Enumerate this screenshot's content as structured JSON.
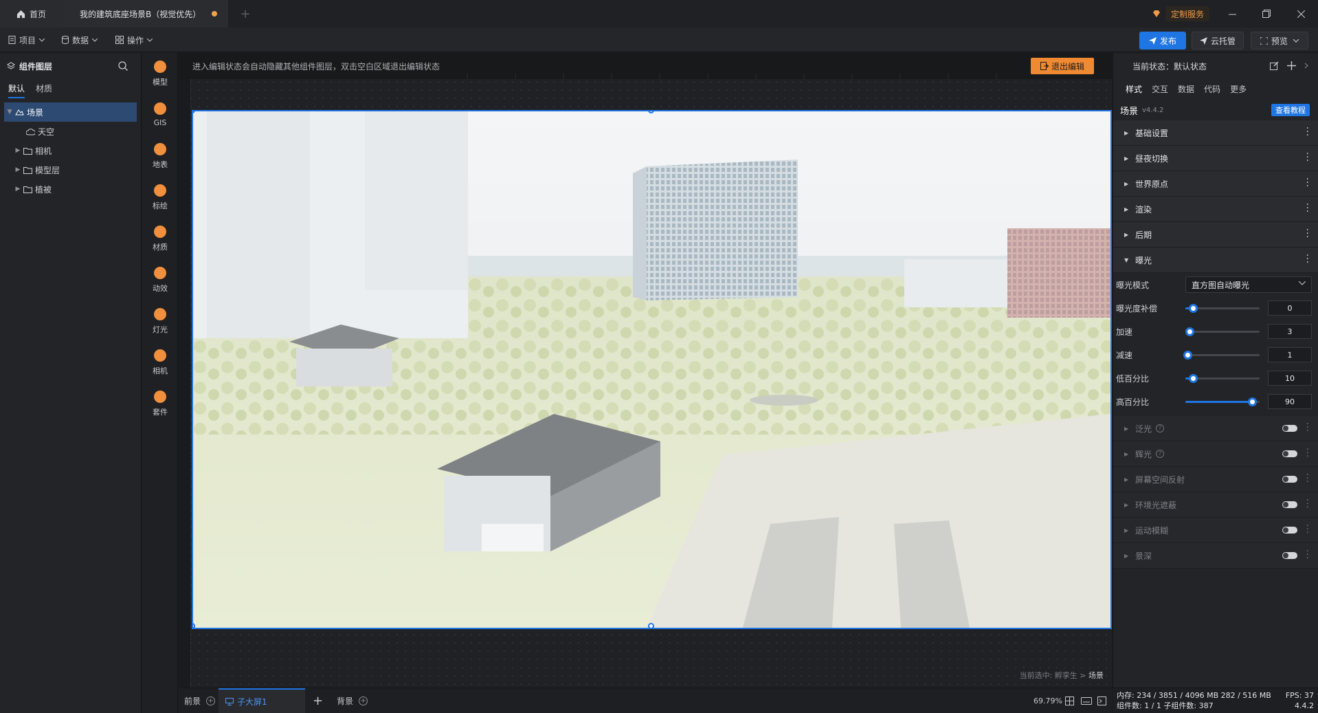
{
  "titlebar": {
    "home_tab": "首页",
    "doc_tab": "我的建筑底座场景B（视觉优先）",
    "custom_service": "定制服务"
  },
  "menubar": {
    "project": "项目",
    "data": "数据",
    "operation": "操作",
    "publish": "发布",
    "cloud": "云托管",
    "preview": "预览"
  },
  "layers": {
    "title": "组件图层",
    "tabs": [
      "默认",
      "材质"
    ],
    "tree": [
      {
        "label": "场景",
        "icon": "scene-icon"
      },
      {
        "label": "天空",
        "icon": "cloud-icon"
      },
      {
        "label": "相机",
        "icon": "folder-icon"
      },
      {
        "label": "模型层",
        "icon": "folder-icon"
      },
      {
        "label": "植被",
        "icon": "folder-icon"
      }
    ]
  },
  "components": [
    "模型",
    "GIS",
    "地表",
    "标绘",
    "材质",
    "动效",
    "灯光",
    "相机",
    "套件"
  ],
  "canvas": {
    "hint": "进入编辑状态会自动隐藏其他组件图层，双击空白区域退出编辑状态",
    "exit_edit": "退出编辑",
    "selected_prefix": "当前选中: 孵孪生 >",
    "selected_current": "场景"
  },
  "bottom": {
    "foreground": "前景",
    "main_screen": "子大屏1",
    "background": "背景",
    "zoom": "69.79%"
  },
  "props": {
    "state": "当前状态：默认状态",
    "tabs": [
      "样式",
      "交互",
      "数据",
      "代码",
      "更多"
    ],
    "scene_title": "场景",
    "scene_version": "v4.4.2",
    "tutorial": "查看教程",
    "sections_top": [
      "基础设置",
      "昼夜切换",
      "世界原点",
      "渲染",
      "后期"
    ],
    "exposure_section": "曝光",
    "exposure_mode_label": "曝光模式",
    "exposure_mode_value": "直方图自动曝光",
    "sliders": [
      {
        "label": "曝光度补偿",
        "value": "0",
        "fraction": 0.1
      },
      {
        "label": "加速",
        "value": "3",
        "fraction": 0.06
      },
      {
        "label": "减速",
        "value": "1",
        "fraction": 0.03
      },
      {
        "label": "低百分比",
        "value": "10",
        "fraction": 0.1
      },
      {
        "label": "高百分比",
        "value": "90",
        "fraction": 0.9
      }
    ],
    "sections_bottom": [
      {
        "label": "泛光",
        "help": true
      },
      {
        "label": "辉光",
        "help": true
      },
      {
        "label": "屏幕空间反射",
        "help": false
      },
      {
        "label": "环境光遮蔽",
        "help": false
      },
      {
        "label": "运动模糊",
        "help": false
      },
      {
        "label": "景深",
        "help": false
      }
    ]
  },
  "status": {
    "memory": "内存: 234 / 3851 / 4096 MB  282 / 516 MB",
    "fps": "FPS: 37",
    "components": "组件数: 1 / 1   子组件数: 387",
    "version": "4.4.2"
  },
  "colors": {
    "accent": "#1f76e3",
    "orange": "#f08a32"
  }
}
